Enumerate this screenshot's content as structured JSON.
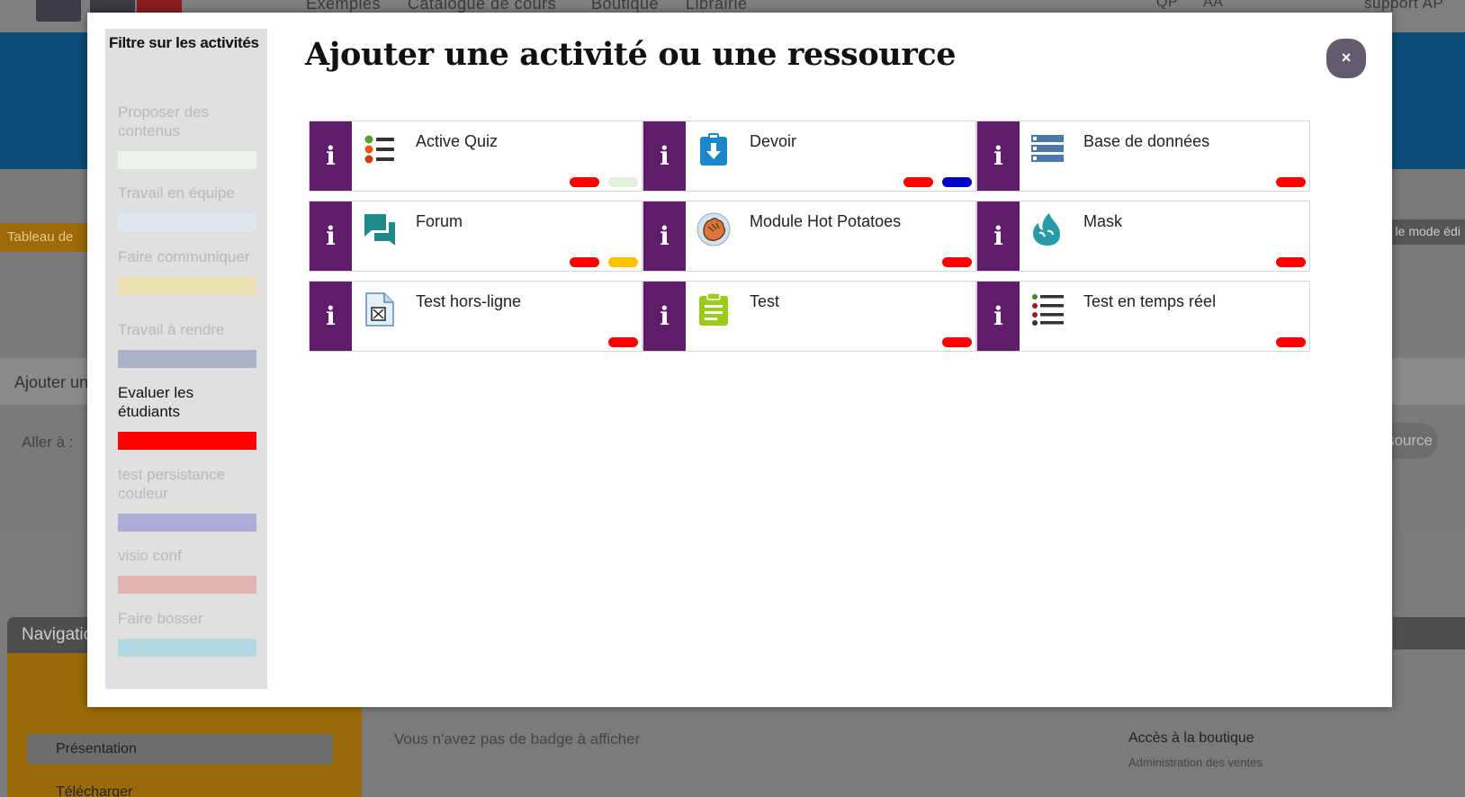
{
  "background": {
    "nav_links": [
      "Exemples",
      "Catalogue de cours",
      "Boutique",
      "Librairie"
    ],
    "top_right_buttons": [
      "QP",
      "AA"
    ],
    "support_text": "support AP",
    "dashboard_tab": "Tableau de",
    "edit_mode_text": "r le mode édi",
    "add_text": "Ajouter un",
    "goto_label": "Aller à :",
    "resource_button": "source",
    "navigation_title": "Navigatio",
    "nav_items": [
      "Présentation",
      "Télécharger"
    ],
    "badge_text": "Vous n'avez pas de badge à afficher",
    "shop_link": "Accès à la boutique",
    "shop_sub": "Administration des ventes"
  },
  "modal": {
    "title": "Ajouter une activité ou une ressource",
    "close_label": "×",
    "filter": {
      "title": "Filtre sur les activités",
      "items": [
        {
          "label": "Proposer des contenus",
          "color": "#eef2ec",
          "active": false
        },
        {
          "label": "Travail en équipe",
          "color": "#dfe9ef",
          "active": false
        },
        {
          "label": "Faire communiquer",
          "color": "#ecdfb1",
          "active": false
        },
        {
          "label": "Travail à rendre",
          "color": "#aab3c6",
          "active": false
        },
        {
          "label": "Evaluer les étudiants",
          "color": "#ff0000",
          "active": true
        },
        {
          "label": "test persistance couleur",
          "color": "#adadd8",
          "active": false
        },
        {
          "label": "visio conf",
          "color": "#e3b4b4",
          "active": false
        },
        {
          "label": "Faire bosser",
          "color": "#b2d8e2",
          "active": false
        }
      ]
    },
    "info_label": "i",
    "activities": [
      {
        "name": "Active Quiz",
        "icon": "quiz-list-icon",
        "tags": [
          "#ff0000",
          "#e2f0dc"
        ]
      },
      {
        "name": "Devoir",
        "icon": "assignment-download-icon",
        "tags": [
          "#ff0000",
          "#0000c8"
        ]
      },
      {
        "name": "Base de données",
        "icon": "database-icon",
        "tags": [
          "#ff0000"
        ]
      },
      {
        "name": "Forum",
        "icon": "forum-chat-icon",
        "tags": [
          "#ff0000",
          "#ffc000"
        ]
      },
      {
        "name": "Module Hot Potatoes",
        "icon": "hot-potatoes-hand-icon",
        "tags": [
          "#ff0000"
        ]
      },
      {
        "name": "Mask",
        "icon": "mask-flame-icon",
        "tags": [
          "#ff0000"
        ]
      },
      {
        "name": "Test hors-ligne",
        "icon": "offline-test-sheet-icon",
        "tags": [
          "#ff0000"
        ]
      },
      {
        "name": "Test",
        "icon": "quiz-clipboard-icon",
        "tags": [
          "#ff0000"
        ]
      },
      {
        "name": "Test en temps réel",
        "icon": "realtime-quiz-list-icon",
        "tags": [
          "#ff0000"
        ]
      }
    ]
  }
}
